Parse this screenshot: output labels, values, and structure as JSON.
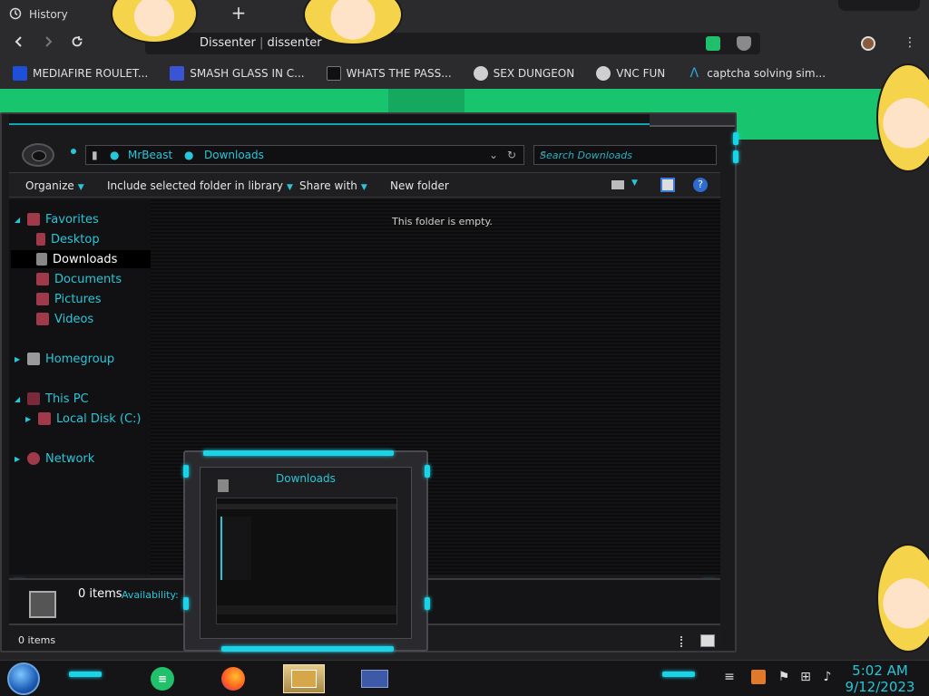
{
  "browser": {
    "tab_label": "History",
    "new_tab_symbol": "+",
    "url_text_1": "Dissenter",
    "url_text_2": "dissenter",
    "menu_symbol": "⋮"
  },
  "bookmarks": [
    {
      "label": "MEDIAFIRE ROULET...",
      "icon": "mediafire-icon",
      "color": "#1e4fd8"
    },
    {
      "label": "SMASH GLASS IN C...",
      "icon": "powershell-icon",
      "color": "#3b54d6"
    },
    {
      "label": "WHATS THE PASS...",
      "icon": "terminal-icon",
      "color": "#111111"
    },
    {
      "label": "SEX DUNGEON",
      "icon": "gear-icon",
      "color": "#cfcfcf"
    },
    {
      "label": "VNC FUN",
      "icon": "gear-icon",
      "color": "#cfcfcf"
    },
    {
      "label": "captcha solving sim...",
      "icon": "arch-icon",
      "color": "#2aa8e0"
    }
  ],
  "explorer": {
    "breadcrumb_1": "MrBeast",
    "breadcrumb_2": "Downloads",
    "search_placeholder": "Search Downloads",
    "toolbar": {
      "organize": "Organize",
      "include": "Include selected folder in library",
      "share": "Share with",
      "new_folder": "New folder"
    },
    "nav": {
      "favorites": "Favorites",
      "desktop": "Desktop",
      "downloads": "Downloads",
      "documents": "Documents",
      "pictures": "Pictures",
      "videos": "Videos",
      "homegroup": "Homegroup",
      "this_pc": "This PC",
      "local_disk": "Local Disk (C:)",
      "network": "Network"
    },
    "empty_message": "This folder is empty.",
    "details_items": "0 items",
    "details_availability": "Availability:",
    "status_items": "0 items"
  },
  "preview": {
    "title": "Downloads"
  },
  "taskbar": {
    "time": "5:02 AM",
    "date": "9/12/2023"
  },
  "colors": {
    "accent_cyan": "#27c6d8",
    "page_green": "#19c46f"
  }
}
